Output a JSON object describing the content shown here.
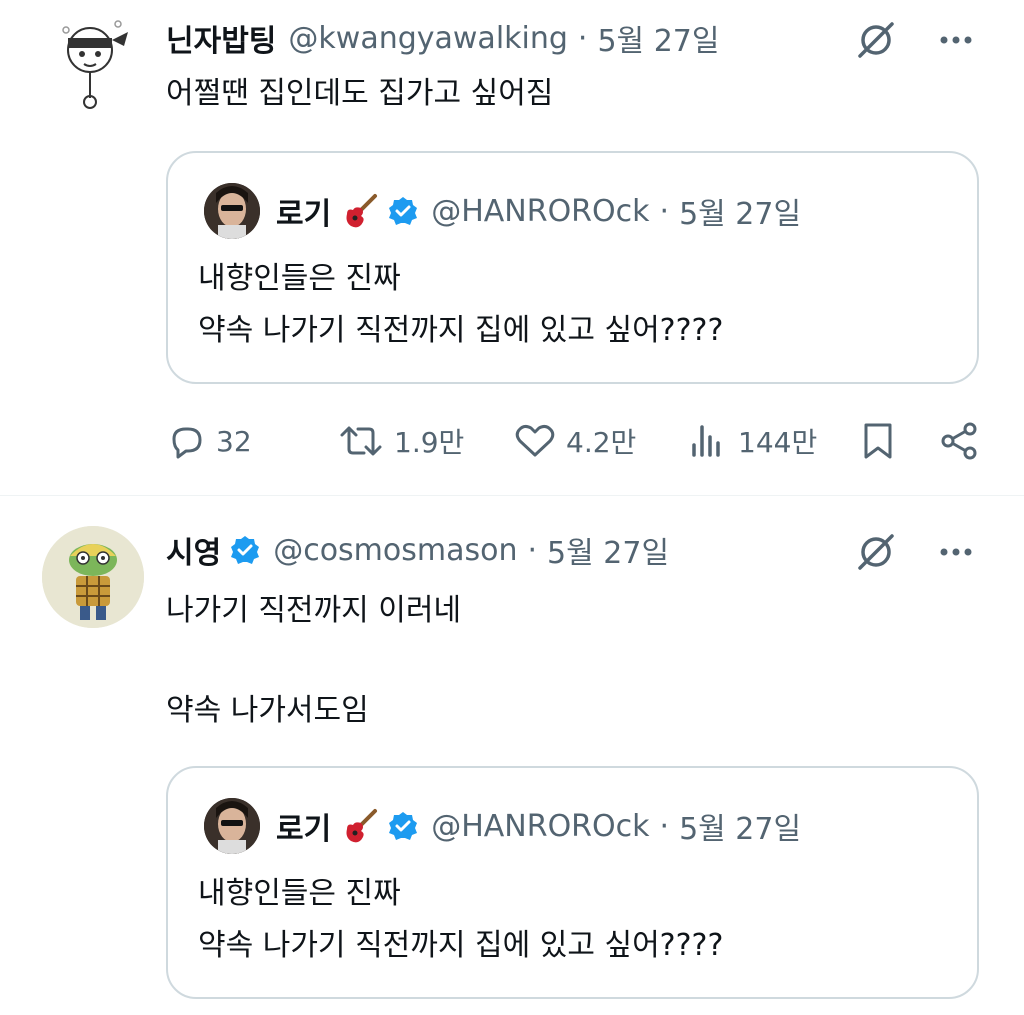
{
  "tweets": [
    {
      "name": "닌자밥팅",
      "handle": "@kwangyawalking",
      "sep": "·",
      "date": "5월 27일",
      "text_lines": [
        "어쩔땐 집인데도 집가고 싶어짐"
      ],
      "quote": {
        "name": "로기",
        "handle": "@HANROROck",
        "sep": "·",
        "date": "5월 27일",
        "text_lines": [
          "내향인들은 진짜",
          "약속 나가기 직전까지 집에 있고 싶어????"
        ]
      },
      "actions": {
        "replies": "32",
        "retweets": "1.9만",
        "likes": "4.2만",
        "views": "144만"
      }
    },
    {
      "name": "시영",
      "handle": "@cosmosmason",
      "sep": "·",
      "date": "5월 27일",
      "text_lines": [
        "나가기 직전까지 이러네",
        "",
        "약속 나가서도임"
      ],
      "quote": {
        "name": "로기",
        "handle": "@HANROROck",
        "sep": "·",
        "date": "5월 27일",
        "text_lines": [
          "내향인들은 진짜",
          "약속 나가기 직전까지 집에 있고 싶어????"
        ]
      }
    }
  ],
  "colors": {
    "verified": "#1d9bf0",
    "muted": "#536471",
    "border": "#cfd9de"
  },
  "icons": [
    "grok-icon",
    "more-icon",
    "reply-icon",
    "retweet-icon",
    "like-icon",
    "views-icon",
    "bookmark-icon",
    "share-icon",
    "verified-badge-icon",
    "guitar-emoji-icon"
  ]
}
